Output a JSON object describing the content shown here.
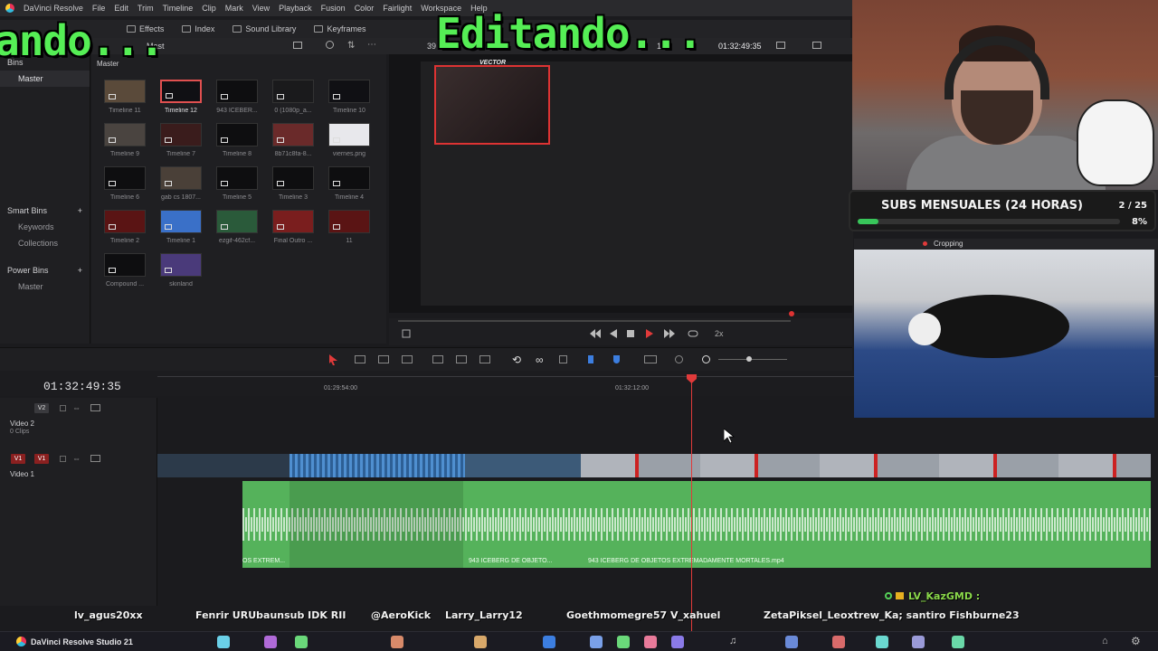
{
  "app": {
    "menu": [
      "DaVinci Resolve",
      "File",
      "Edit",
      "Trim",
      "Timeline",
      "Clip",
      "Mark",
      "View",
      "Playback",
      "Fusion",
      "Color",
      "Fairlight",
      "Workspace",
      "Help"
    ]
  },
  "toolbar": {
    "effects": "Effects",
    "index": "Index",
    "sound_library": "Sound Library",
    "keyframes": "Keyframes"
  },
  "media_pool": {
    "master_label": "Mast",
    "breadcrumb": "Master",
    "bins_title": "Bins",
    "bins": [
      "Master"
    ],
    "smart_bins_title": "Smart Bins",
    "smart_bins": [
      "Keywords",
      "Collections"
    ],
    "power_bins_title": "Power Bins",
    "power_bins": [
      "Master"
    ],
    "clips": [
      "Timeline 11",
      "Timeline 12",
      "943 ICEBER...",
      "0 (1080p_a...",
      "Timeline 10",
      "Timeline 9",
      "Timeline 7",
      "Timeline 8",
      "8b71c8fa-8...",
      "viernes.png",
      "Timeline 6",
      "gab cs 1807...",
      "Timeline 5",
      "Timeline 3",
      "Timeline 4",
      "Timeline 2",
      "Timeline 1",
      "ezgif-462cf...",
      "Final Outro ...",
      "11",
      "Compound ...",
      "skinland"
    ]
  },
  "viewer": {
    "zoom": "39",
    "timecode_right": "01:32:49:35",
    "timecode_partial": "12",
    "pip_label": "VECTOR",
    "speed": "2x"
  },
  "timeline": {
    "timecode": "01:32:49:35",
    "ruler": [
      "01:29:54:00",
      "01:32:12:00"
    ],
    "tracks": {
      "v2_badge": "V2",
      "v2_name": "Video 2",
      "v2_clips": "0 Clips",
      "v1_badge_a": "V1",
      "v1_badge_b": "V1",
      "v1_name": "Video 1"
    },
    "audio_labels": [
      "OS EXTREM...",
      "943 ICEBERG DE OBJETO...",
      "943 ICEBERG DE OBJETOS EXTREMADAMENTE MORTALES.mp4"
    ]
  },
  "overlay": {
    "left_text": "ando...",
    "center_text": "Editando...",
    "subs_title": "SUBS MENSUALES (24 HORAS)",
    "subs_count": "2 / 25",
    "subs_pct": "8%",
    "subs_progress": 0.08,
    "cam2_label": "Cropping"
  },
  "chat": {
    "highlight_user": "LV_KazGMD :",
    "names": [
      "lv_agus20xx",
      "Fenrir URUbaunsub IDK RII",
      "@AeroKick",
      "Larry_Larry12",
      "Goethmomegre57 V_xahuel",
      "ZetaPiksel_Leoxtrew_Ka; santiro Fishburne23"
    ]
  },
  "taskbar": {
    "label": "DaVinci Resolve Studio 21"
  },
  "colors": {
    "overlay_green": "#55ee55",
    "audio_green": "#55b25b",
    "playhead_red": "#e03a3a",
    "progress_green": "#38c65a"
  }
}
